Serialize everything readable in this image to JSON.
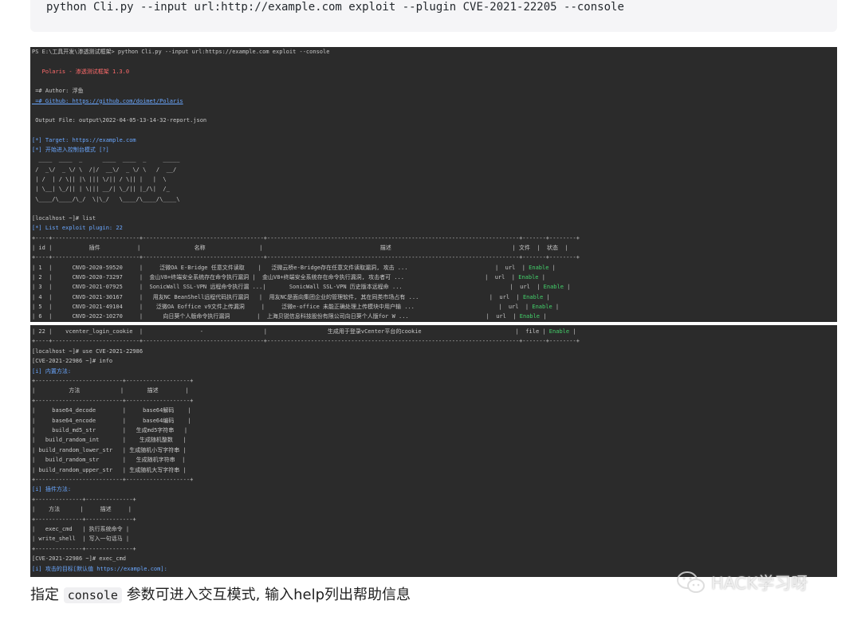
{
  "code_block": {
    "command": "python Cli.py --input url:http://example.com exploit --plugin CVE-2021-22205 --console"
  },
  "terminal1": {
    "lines": [
      {
        "text": "PS E:\\工具开发\\渗透测试框架> python Cli.py --input url:https://example.com exploit --console",
        "cls": ""
      },
      {
        "text": "",
        "cls": ""
      },
      {
        "text": "   Polaris - 渗透测试框架 1.3.0",
        "cls": "r"
      },
      {
        "text": "",
        "cls": ""
      },
      {
        "text": " =# Author: 浮鱼",
        "cls": ""
      },
      {
        "text": " =# Github: https://github.com/doimet/Polaris",
        "cls": "u"
      },
      {
        "text": "",
        "cls": ""
      },
      {
        "text": " Output File: output\\2022-04-05-13-14-32-report.json",
        "cls": ""
      },
      {
        "text": "",
        "cls": ""
      },
      {
        "text": "[*] Target: https://example.com",
        "cls": "b"
      },
      {
        "text": "[*] 开始进入控制台模式 [?]",
        "cls": "b"
      },
      {
        "text": "  ____  ____  _      ____  ____  _     _____",
        "cls": ""
      },
      {
        "text": " /  _\\/  _ \\/ \\  /|/  __\\/  _ \\/ \\   /  __/",
        "cls": ""
      },
      {
        "text": " | /  | / \\|| |\\ ||| \\/|| / \\|| |   |  \\",
        "cls": ""
      },
      {
        "text": " | \\__| \\_/|| | \\||| __/| \\_/|| |_/\\|  /_",
        "cls": ""
      },
      {
        "text": " \\____/\\____/\\_/  \\|\\_/   \\____/\\____/\\____\\",
        "cls": ""
      },
      {
        "text": "",
        "cls": ""
      },
      {
        "text": "[localhost ~]# list",
        "cls": ""
      },
      {
        "text": "[*] List exploit plugin: 22",
        "cls": "b"
      },
      {
        "text": "+----+--------------------------+------------------------------------+---------------------------------------------------------------------------+-------+--------+",
        "cls": ""
      },
      {
        "text": "| id |           插件           |                名称                |                                   描述                                    | 文件  |  状态  |",
        "cls": ""
      },
      {
        "text": "+----+--------------------------+------------------------------------+---------------------------------------------------------------------------+-------+--------+",
        "cls": ""
      },
      {
        "text": "| 1  |      CNVD-2020-59520     |     泛微OA E-Bridge 任意文件读取    |   泛微云桥e-Bridge存在任意文件读取漏洞, 攻击 ...                          |  url  | Enable |",
        "cls": ""
      },
      {
        "text": "| 2  |      CNVD-2020-73297     |  金山V8+终端安全系统存在命令执行漏洞 |  金山V8+终端安全系统存在命令执行漏洞, 攻击者可 ...                        |  url  | Enable |",
        "cls": ""
      },
      {
        "text": "| 3  |      CNVD-2021-07925     |  SonicWall SSL-VPN 远程命令执行漏 ...|       SonicWall SSL-VPN 历史版本远程命 ...                                |  url  | Enable |",
        "cls": ""
      },
      {
        "text": "| 4  |      CNVD-2021-30167     |   用友NC BeanShell远程代码执行漏洞   |  用友NC是面向集团企业的管理软件, 其在同类市场占有 ...                     |  url  | Enable |",
        "cls": ""
      },
      {
        "text": "| 5  |      CNVD-2021-49104     |    泛微OA Eoffice v9文件上传漏洞     |     泛微e-office 未能正确处理上传模块中用户输 ...                         |  url  | Enable |",
        "cls": ""
      },
      {
        "text": "| 6  |      CNVD-2022-10270     |      向日葵个人版命令执行漏洞        |  上海贝锐信息科技股份有限公司向日葵个人版for W ...                       |  url  | Enable |",
        "cls": ""
      }
    ]
  },
  "terminal2": {
    "lines": [
      {
        "text": "| 22 |    vcenter_login_cookie  |                 -                  |                  生成用于登录vCenter平台的cookie                            |  file | Enable |",
        "cls": ""
      },
      {
        "text": "+----+--------------------------+------------------------------------+---------------------------------------------------------------------------+-------+--------+",
        "cls": ""
      },
      {
        "text": "[localhost ~]# use CVE-2021-22986",
        "cls": ""
      },
      {
        "text": "[CVE-2021-22986 ~]# info",
        "cls": ""
      },
      {
        "text": "[i] 内置方法:",
        "cls": "b"
      },
      {
        "text": "+--------------------------+-------------------+",
        "cls": ""
      },
      {
        "text": "|          方法            |       描述        |",
        "cls": ""
      },
      {
        "text": "+--------------------------+-------------------+",
        "cls": ""
      },
      {
        "text": "|     base64_decode        |     base64解码    |",
        "cls": ""
      },
      {
        "text": "|     base64_encode        |     base64编码    |",
        "cls": ""
      },
      {
        "text": "|     build_md5_str        |   生成md5字符串   |",
        "cls": ""
      },
      {
        "text": "|   build_random_int       |    生成随机整数   |",
        "cls": ""
      },
      {
        "text": "| build_random_lower_str   | 生成随机小写字符串 |",
        "cls": ""
      },
      {
        "text": "|   build_random_str       |   生成随机字符串  |",
        "cls": ""
      },
      {
        "text": "| build_random_upper_str   | 生成随机大写字符串 |",
        "cls": ""
      },
      {
        "text": "+--------------------------+-------------------+",
        "cls": ""
      },
      {
        "text": "[i] 插件方法:",
        "cls": "b"
      },
      {
        "text": "+--------------+--------------+",
        "cls": ""
      },
      {
        "text": "|    方法      |     描述     |",
        "cls": ""
      },
      {
        "text": "+--------------+--------------+",
        "cls": ""
      },
      {
        "text": "|   exec_cmd   | 执行系统命令 |",
        "cls": ""
      },
      {
        "text": "| write_shell  | 写入一句话马 |",
        "cls": ""
      },
      {
        "text": "+--------------+--------------+",
        "cls": ""
      },
      {
        "text": "[CVE-2021-22986 ~]# exec_cmd",
        "cls": ""
      },
      {
        "text": "[i] 攻击的目标[默认值 https://example.com]:",
        "cls": "b"
      }
    ]
  },
  "caption": {
    "before": "指定",
    "code": "console",
    "after": "参数可进入交互模式, 输入help列出帮助信息"
  },
  "watermark": {
    "text": "HACK学习呀"
  },
  "colors": {
    "terminal_bg": "#2b2b2b",
    "prompt_yellow": "#d7c24a",
    "banner_red": "#ff6b6b",
    "info_blue": "#6aa7ff",
    "enable_green": "#43d06a"
  }
}
